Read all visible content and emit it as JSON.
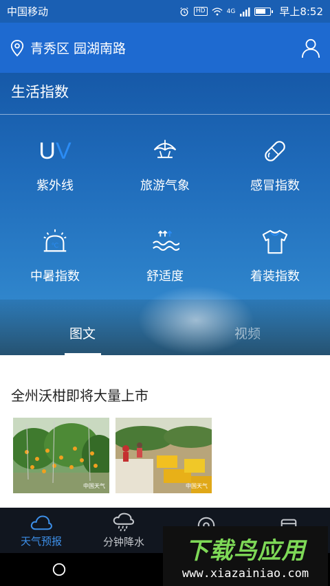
{
  "status_bar": {
    "carrier": "中国移动",
    "hd": "HD",
    "network": "4G",
    "time": "早上8:52"
  },
  "location": {
    "text": "青秀区 园湖南路",
    "pin_icon": "location-pin-icon",
    "profile_icon": "user-icon"
  },
  "life_index": {
    "title": "生活指数",
    "items": [
      {
        "label": "紫外线",
        "icon": "uv-icon",
        "icon_text_u": "U",
        "icon_text_v": "V"
      },
      {
        "label": "旅游气象",
        "icon": "beach-umbrella-icon"
      },
      {
        "label": "感冒指数",
        "icon": "pill-icon"
      },
      {
        "label": "中暑指数",
        "icon": "siren-thermometer-icon",
        "icon_text": "℃"
      },
      {
        "label": "舒适度",
        "icon": "waves-icon"
      },
      {
        "label": "着装指数",
        "icon": "tshirt-icon"
      }
    ]
  },
  "tabs": [
    {
      "label": "图文",
      "active": true
    },
    {
      "label": "视频",
      "active": false
    }
  ],
  "article": {
    "title": "全州沃柑即将大量上市",
    "thumb_watermark": "中国天气"
  },
  "bottom_nav": [
    {
      "label": "天气预报",
      "icon": "cloud-icon",
      "active": true
    },
    {
      "label": "分钟降水",
      "icon": "rain-cloud-icon",
      "active": false
    },
    {
      "label": "",
      "icon": "location-target-icon",
      "active": false
    },
    {
      "label": "",
      "icon": "box-icon",
      "active": false
    }
  ],
  "watermark": {
    "brand": "下载鸟应用",
    "url": "www.xiazainiao.com"
  },
  "colors": {
    "accent": "#3d8fe8",
    "header": "#1e6ad0",
    "uv_v": "#2b8cf5"
  }
}
